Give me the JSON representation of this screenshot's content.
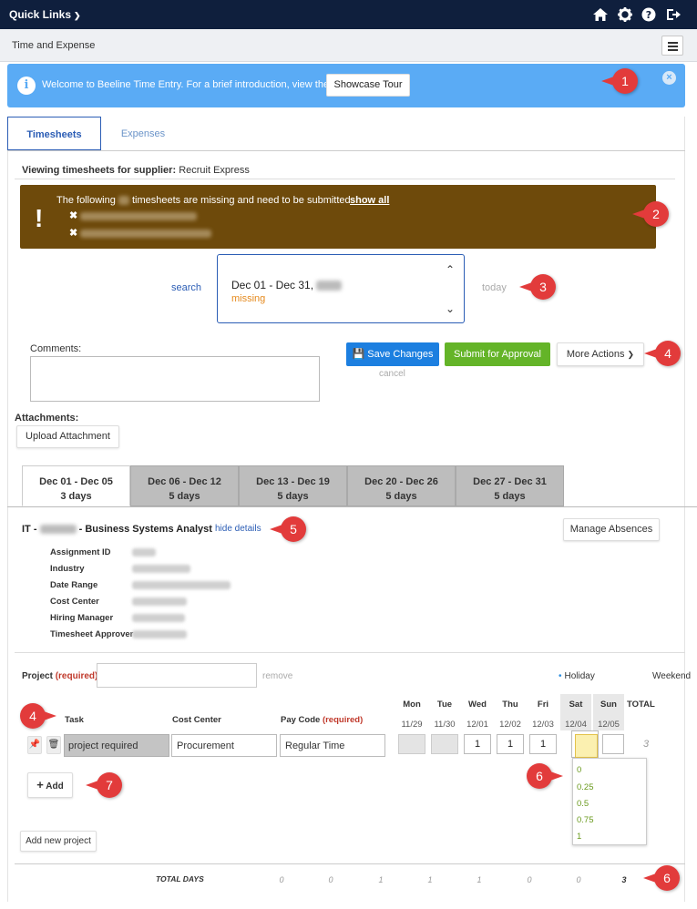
{
  "topbar": {
    "quick_links": "Quick Links"
  },
  "app": {
    "title": "Time and Expense"
  },
  "banner": {
    "text": "Welcome to Beeline Time Entry. For a brief introduction, view the",
    "tour_button": "Showcase Tour"
  },
  "tabs": [
    {
      "label": "Timesheets"
    },
    {
      "label": "Expenses"
    }
  ],
  "supplier": {
    "label": "Viewing timesheets for supplier:",
    "name": "Recruit Express"
  },
  "missing": {
    "text_before": "The following",
    "text_after": "timesheets are missing and need to be submitted.",
    "show_all": "show all"
  },
  "period": {
    "search": "search",
    "range": "Dec 01 - Dec 31,",
    "status": "missing",
    "today": "today"
  },
  "actions": {
    "comments_label": "Comments:",
    "save": "Save Changes",
    "submit": "Submit for Approval",
    "more": "More Actions",
    "cancel": "cancel"
  },
  "attachments": {
    "label": "Attachments:",
    "upload": "Upload Attachment"
  },
  "weeks": [
    {
      "range": "Dec 01 - Dec 05",
      "days": "3 days"
    },
    {
      "range": "Dec 06 - Dec 12",
      "days": "5 days"
    },
    {
      "range": "Dec 13 - Dec 19",
      "days": "5 days"
    },
    {
      "range": "Dec 20 - Dec 26",
      "days": "5 days"
    },
    {
      "range": "Dec 27 - Dec 31",
      "days": "5 days"
    }
  ],
  "assignment": {
    "prefix": "IT -",
    "title": "- Business Systems Analyst",
    "hide_details": "hide details",
    "manage_absences": "Manage Absences",
    "fields": [
      "Assignment ID",
      "Industry",
      "Date Range",
      "Cost Center",
      "Hiring Manager",
      "Timesheet Approver"
    ]
  },
  "entry": {
    "project_label": "Project",
    "required": "(required)",
    "remove": "remove",
    "holiday": "Holiday",
    "weekend": "Weekend",
    "col_task": "Task",
    "col_cost_center": "Cost Center",
    "col_pay_code": "Pay Code",
    "col_total": "TOTAL",
    "days": [
      "Mon",
      "Tue",
      "Wed",
      "Thu",
      "Fri",
      "Sat",
      "Sun"
    ],
    "dates": [
      "11/29",
      "11/30",
      "12/01",
      "12/02",
      "12/03",
      "12/04",
      "12/05"
    ],
    "task_value": "project required",
    "cost_center_value": "Procurement",
    "pay_code_value": "Regular Time",
    "day_values": [
      "",
      "",
      "1",
      "1",
      "1",
      "",
      ""
    ],
    "row_total": "3",
    "dropdown_options": [
      "0",
      "0.25",
      "0.5",
      "0.75",
      "1"
    ],
    "add": "Add",
    "add_project": "Add new project",
    "total_days_label": "TOTAL DAYS",
    "totals": [
      "0",
      "0",
      "1",
      "1",
      "1",
      "0",
      "0",
      "3"
    ]
  },
  "callouts": [
    "1",
    "2",
    "3",
    "4",
    "4",
    "5",
    "6",
    "6",
    "7"
  ]
}
